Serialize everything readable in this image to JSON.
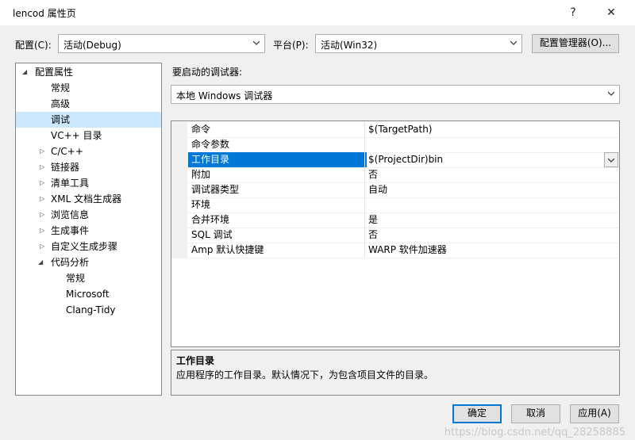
{
  "window": {
    "title": "lencod 属性页",
    "help": "?",
    "close": "✕"
  },
  "config": {
    "label": "配置(C):",
    "value": "活动(Debug)"
  },
  "platform": {
    "label": "平台(P):",
    "value": "活动(Win32)"
  },
  "config_manager_label": "配置管理器(O)...",
  "tree": {
    "root": "配置属性",
    "items": [
      "常规",
      "高级",
      "调试",
      "VC++ 目录",
      "C/C++",
      "链接器",
      "清单工具",
      "XML 文档生成器",
      "浏览信息",
      "生成事件",
      "自定义生成步骤",
      "代码分析"
    ],
    "code_analysis_children": [
      "常规",
      "Microsoft",
      "Clang-Tidy"
    ]
  },
  "debugger": {
    "label": "要启动的调试器:",
    "value": "本地 Windows 调试器"
  },
  "props": [
    {
      "name": "命令",
      "value": "$(TargetPath)"
    },
    {
      "name": "命令参数",
      "value": ""
    },
    {
      "name": "工作目录",
      "value": "$(ProjectDir)bin"
    },
    {
      "name": "附加",
      "value": "否"
    },
    {
      "name": "调试器类型",
      "value": "自动"
    },
    {
      "name": "环境",
      "value": ""
    },
    {
      "name": "合并环境",
      "value": "是"
    },
    {
      "name": "SQL 调试",
      "value": "否"
    },
    {
      "name": "Amp 默认快捷键",
      "value": "WARP 软件加速器"
    }
  ],
  "description": {
    "title": "工作目录",
    "text": "应用程序的工作目录。默认情况下，为包含项目文件的目录。"
  },
  "buttons": {
    "ok": "确定",
    "cancel": "取消",
    "apply": "应用(A)"
  },
  "watermark": "https://blog.csdn.net/qq_28258885",
  "colors": {
    "accent": "#0078d7",
    "selection_tree": "#cce8ff"
  }
}
